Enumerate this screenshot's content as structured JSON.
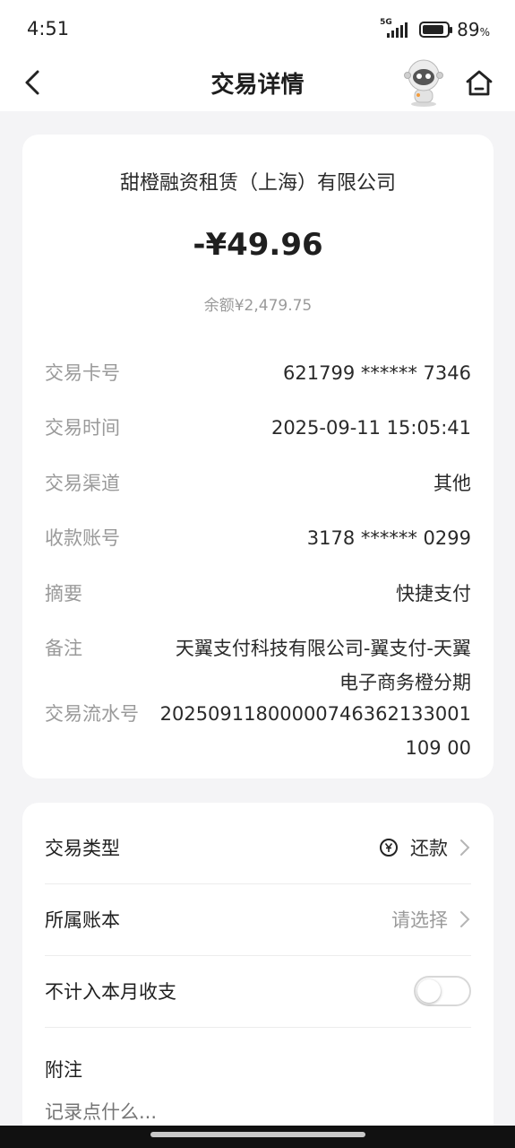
{
  "status_bar": {
    "time": "4:51",
    "network": "5G",
    "battery_level": 0.89,
    "battery_percent": "89",
    "battery_unit": "%"
  },
  "header": {
    "title": "交易详情",
    "back_icon": "chevron-left-icon",
    "mascot_icon": "astronaut-mascot-icon",
    "home_icon": "home-icon"
  },
  "transaction": {
    "merchant": "甜橙融资租赁（上海）有限公司",
    "amount": "-¥49.96",
    "balance": "余额¥2,479.75",
    "details": [
      {
        "label": "交易卡号",
        "value": "621799 ****** 7346"
      },
      {
        "label": "交易时间",
        "value": "2025-09-11 15:05:41"
      },
      {
        "label": "交易渠道",
        "value": "其他"
      },
      {
        "label": "收款账号",
        "value": "3178 ****** 0299"
      },
      {
        "label": "摘要",
        "value": "快捷支付"
      },
      {
        "label": "备注",
        "value": "天翼支付科技有限公司-翼支付-天翼电子商务橙分期"
      },
      {
        "label": "交易流水号",
        "value": "20250911800000746362133001109 00"
      }
    ]
  },
  "settings": {
    "type_label": "交易类型",
    "type_value": "还款",
    "type_icon": "yuan-circle-icon",
    "book_label": "所属账本",
    "book_value": "请选择",
    "exclude_label": "不计入本月收支",
    "exclude_enabled": false,
    "note_label": "附注",
    "note_placeholder": "记录点什么..."
  },
  "colors": {
    "background": "#f4f4f6",
    "card": "#ffffff",
    "muted_text": "#9a9a9a"
  }
}
